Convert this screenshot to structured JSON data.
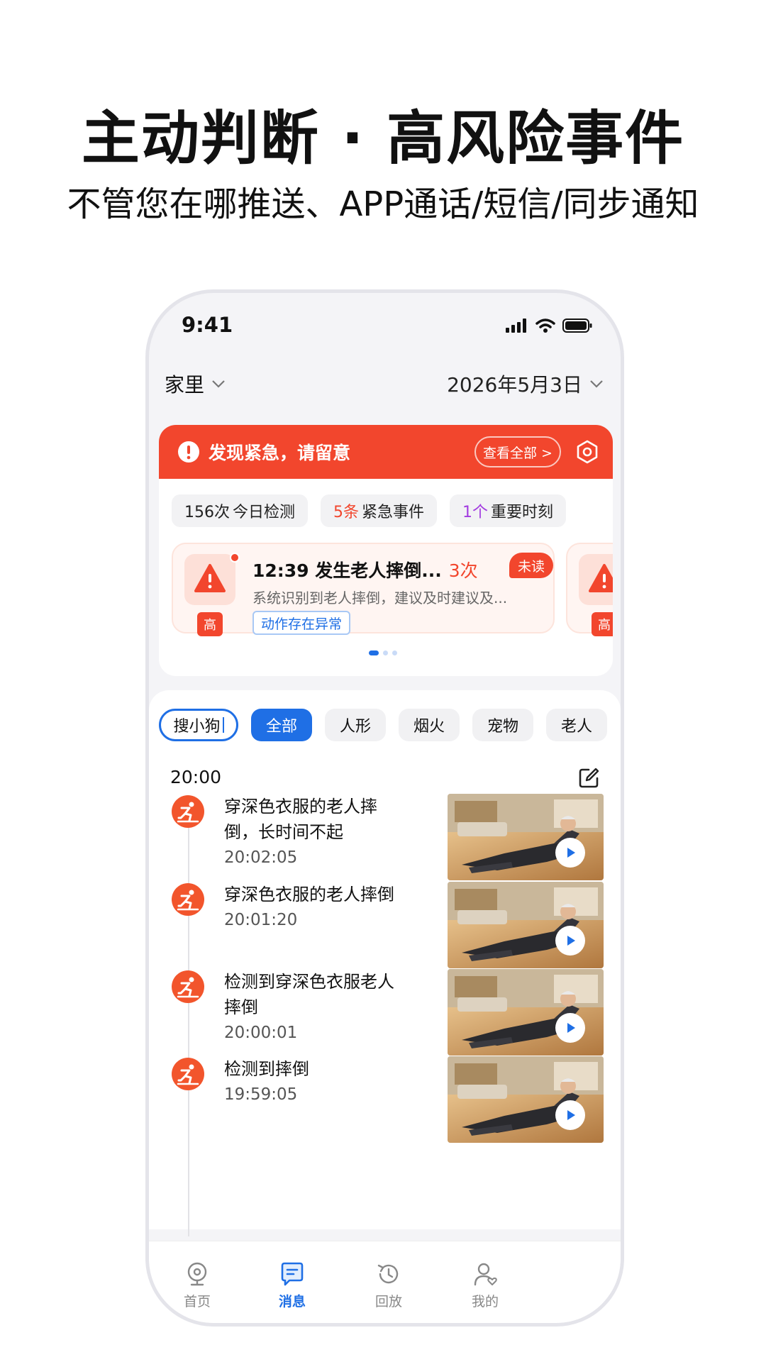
{
  "headline": "主动判断 · 高风险事件",
  "subline": "不管您在哪推送、APP通话/短信/同步通知",
  "status": {
    "time": "9:41"
  },
  "topbar": {
    "location": "家里",
    "date": "2026年5月3日"
  },
  "alert": {
    "title": "发现紧急，请留意",
    "view_all": "查看全部 >",
    "stats": [
      {
        "num": "156次",
        "label": "今日检测",
        "num_color": "#222222"
      },
      {
        "num": "5条",
        "label": "紧急事件",
        "num_color": "#f2462d"
      },
      {
        "num": "1个",
        "label": "重要时刻",
        "num_color": "#a23be0"
      }
    ],
    "event": {
      "title": "12:39  发生老人摔倒...",
      "count": "3次",
      "unread": "未读",
      "desc": "系统识别到老人摔倒，建议及时建议及...",
      "tag": "动作存在异常",
      "level": "高"
    },
    "peek_level": "高"
  },
  "filters": {
    "search": "搜小狗",
    "chips": [
      "全部",
      "人形",
      "烟火",
      "宠物",
      "老人"
    ]
  },
  "group_time": "20:00",
  "events": [
    {
      "title": "穿深色衣服的老人摔倒，长时间不起",
      "time": "20:02:05"
    },
    {
      "title": "穿深色衣服的老人摔倒",
      "time": "20:01:20"
    },
    {
      "title": "检测到穿深色衣服老人摔倒",
      "time": "20:00:01"
    },
    {
      "title": "检测到摔倒",
      "time": "19:59:05"
    }
  ],
  "tabs": [
    "首页",
    "消息",
    "回放",
    "我的"
  ],
  "colors": {
    "accent": "#1f6fe5",
    "alert": "#f2462d"
  }
}
